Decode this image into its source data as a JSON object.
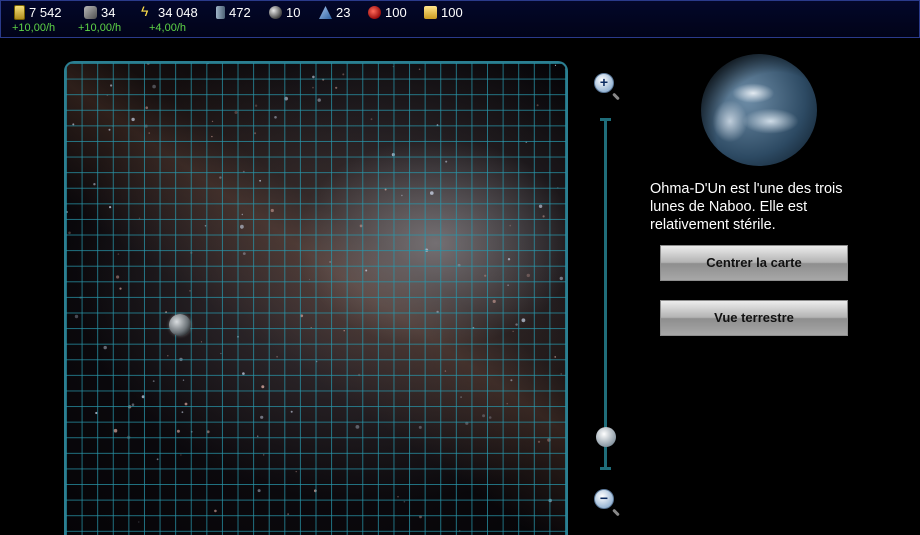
{
  "resources": [
    {
      "icon": "credit-icon",
      "value": "7 542",
      "rate": "+10,00/h"
    },
    {
      "icon": "ore-icon",
      "value": "34",
      "rate": "+10,00/h"
    },
    {
      "icon": "energy-icon",
      "value": "34 048",
      "rate": "+4,00/h"
    },
    {
      "icon": "crystal-icon",
      "value": "472",
      "rate": ""
    },
    {
      "icon": "moon-icon",
      "value": "10",
      "rate": ""
    },
    {
      "icon": "ship-icon",
      "value": "23",
      "rate": ""
    },
    {
      "icon": "food-icon",
      "value": "100",
      "rate": ""
    },
    {
      "icon": "gold-icon",
      "value": "100",
      "rate": ""
    }
  ],
  "map": {
    "selected_body": "Ohma-D'Un",
    "zoom_level_fraction": 0.05
  },
  "zoom": {
    "in_symbol": "+",
    "out_symbol": "−"
  },
  "planet": {
    "description": "Ohma-D'Un est l'une des trois lunes de Naboo. Elle est relativement stérile."
  },
  "buttons": {
    "center": "Centrer la carte",
    "ground": "Vue terrestre"
  }
}
